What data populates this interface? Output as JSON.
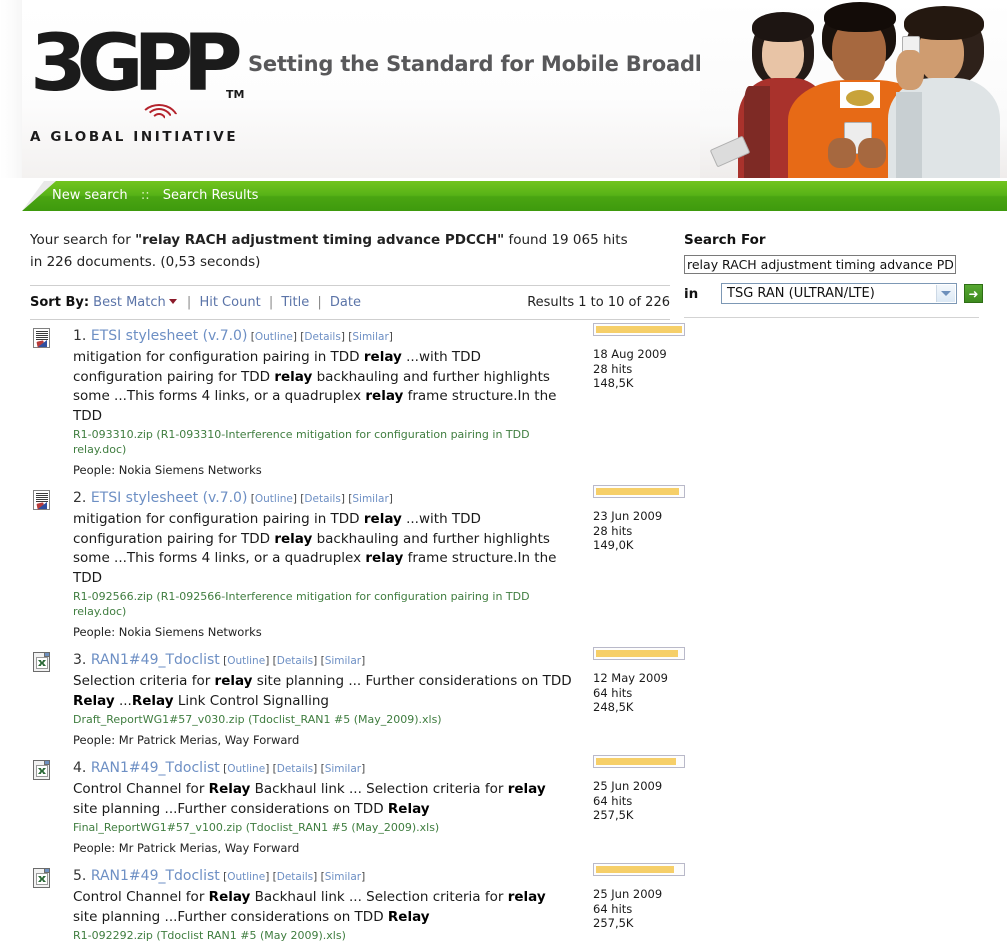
{
  "header": {
    "logo_text": "3GPP",
    "logo_tm": "TM",
    "logo_tagline": "A GLOBAL INITIATIVE",
    "slogan": "Setting the Standard for Mobile Broadband",
    "photo_alt": "three-people-with-mobile-phones-photo"
  },
  "nav": {
    "new_search": "New search",
    "separator": "::",
    "search_results": "Search Results"
  },
  "summary": {
    "prefix": "Your search for ",
    "query": "\"relay RACH adjustment timing advance PDCCH\"",
    "suffix": " found 19 065 hits in 226 documents. (0,53 seconds)"
  },
  "sort": {
    "label": "Sort By:",
    "current": "Best Match",
    "options": [
      "Hit Count",
      "Title",
      "Date"
    ],
    "pipe": "|",
    "results_range": "Results 1 to 10 of 226"
  },
  "search_panel": {
    "title": "Search For",
    "query_value": "relay RACH adjustment timing advance PDCCH",
    "query_placeholder": "",
    "in_label": "in",
    "scope_selected": "TSG RAN (ULTRAN/LTE)",
    "go_label": "➜"
  },
  "result_actions": {
    "outline": "Outline",
    "details": "Details",
    "similar": "Similar",
    "open_bracket": "[",
    "close_bracket": "]"
  },
  "results": [
    {
      "num": "1.",
      "icon": "word-document-icon",
      "title": "ETSI stylesheet (v.7.0)",
      "snippet_parts": [
        {
          "t": "mitigation for configuration pairing in TDD ",
          "b": false
        },
        {
          "t": "relay",
          "b": true
        },
        {
          "t": " ...with TDD configuration pairing for TDD ",
          "b": false
        },
        {
          "t": "relay",
          "b": true
        },
        {
          "t": " backhauling and further highlights some ...This forms 4 links, or a quadruplex ",
          "b": false
        },
        {
          "t": "relay",
          "b": true
        },
        {
          "t": " frame structure.In the TDD",
          "b": false
        }
      ],
      "file": "R1-093310.zip (R1-093310-Interference mitigation for configuration pairing in TDD relay.doc)",
      "people": "People: Nokia Siemens Networks",
      "relevance_pct": 100,
      "date": "18 Aug 2009",
      "hits": "28 hits",
      "size": "148,5K"
    },
    {
      "num": "2.",
      "icon": "word-document-icon",
      "title": "ETSI stylesheet (v.7.0)",
      "snippet_parts": [
        {
          "t": "mitigation for configuration pairing in TDD ",
          "b": false
        },
        {
          "t": "relay",
          "b": true
        },
        {
          "t": " ...with TDD configuration pairing for TDD ",
          "b": false
        },
        {
          "t": "relay",
          "b": true
        },
        {
          "t": " backhauling and further highlights some ...This forms 4 links, or a quadruplex ",
          "b": false
        },
        {
          "t": "relay",
          "b": true
        },
        {
          "t": " frame structure.In the TDD",
          "b": false
        }
      ],
      "file": "R1-092566.zip (R1-092566-Interference mitigation for configuration pairing in TDD relay.doc)",
      "people": "People: Nokia Siemens Networks",
      "relevance_pct": 97,
      "date": "23 Jun 2009",
      "hits": "28 hits",
      "size": "149,0K"
    },
    {
      "num": "3.",
      "icon": "excel-document-icon",
      "title": "RAN1#49_Tdoclist",
      "snippet_parts": [
        {
          "t": "Selection criteria for ",
          "b": false
        },
        {
          "t": "relay",
          "b": true
        },
        {
          "t": " site planning ... Further considerations on TDD ",
          "b": false
        },
        {
          "t": "Relay",
          "b": true
        },
        {
          "t": " ...",
          "b": false
        },
        {
          "t": "Relay",
          "b": true
        },
        {
          "t": " Link Control Signalling",
          "b": false
        }
      ],
      "file": "Draft_ReportWG1#57_v030.zip (Tdoclist_RAN1 #5 (May_2009).xls)",
      "people": "People: Mr Patrick Merias, Way Forward",
      "relevance_pct": 95,
      "date": "12 May 2009",
      "hits": "64 hits",
      "size": "248,5K"
    },
    {
      "num": "4.",
      "icon": "excel-document-icon",
      "title": "RAN1#49_Tdoclist",
      "snippet_parts": [
        {
          "t": "Control Channel for ",
          "b": false
        },
        {
          "t": "Relay",
          "b": true
        },
        {
          "t": " Backhaul link ... Selection criteria for ",
          "b": false
        },
        {
          "t": "relay",
          "b": true
        },
        {
          "t": " site planning ...Further considerations on TDD ",
          "b": false
        },
        {
          "t": "Relay",
          "b": true
        }
      ],
      "file": "Final_ReportWG1#57_v100.zip (Tdoclist_RAN1 #5 (May_2009).xls)",
      "people": "People: Mr Patrick Merias, Way Forward",
      "relevance_pct": 93,
      "date": "25 Jun 2009",
      "hits": "64 hits",
      "size": "257,5K"
    },
    {
      "num": "5.",
      "icon": "excel-document-icon",
      "title": "RAN1#49_Tdoclist",
      "snippet_parts": [
        {
          "t": "Control Channel for ",
          "b": false
        },
        {
          "t": "Relay",
          "b": true
        },
        {
          "t": " Backhaul link ... Selection criteria for ",
          "b": false
        },
        {
          "t": "relay",
          "b": true
        },
        {
          "t": " site planning ...Further considerations on TDD ",
          "b": false
        },
        {
          "t": "Relay",
          "b": true
        }
      ],
      "file": "R1-092292.zip (Tdoclist RAN1 #5 (May 2009).xls)",
      "people": "",
      "relevance_pct": 91,
      "date": "25 Jun 2009",
      "hits": "64 hits",
      "size": "257,5K"
    }
  ],
  "colors": {
    "nav_green": "#4aa512",
    "link_blue": "#6d8fc4",
    "file_green": "#3f7d3f",
    "relevance_yellow": "#f6cf69",
    "logo_red": "#b4232c",
    "slogan_gray": "#58585a"
  }
}
